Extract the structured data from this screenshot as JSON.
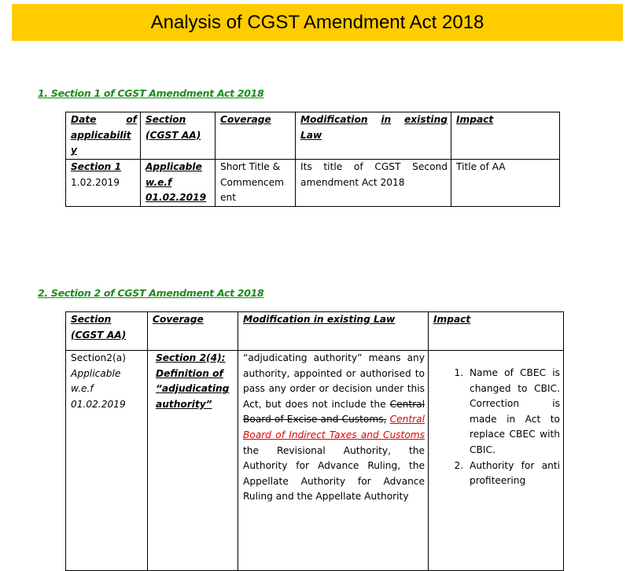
{
  "document": {
    "title": "Analysis of CGST Amendment Act 2018",
    "banner_color": "#FFCC00",
    "heading_color": "#1f8a1f",
    "insert_color": "#e00000"
  },
  "section1": {
    "heading": "1. Section 1 of CGST Amendment Act 2018",
    "columns": [
      "Date of applicabilit y",
      "Section (CGST AA)",
      "Coverage",
      "Modification in existing Law",
      "Impact"
    ],
    "col_date_a": "Date",
    "col_date_b": "of",
    "col_date_c": "applicabilit",
    "col_date_d": "y",
    "col_section_a": "Section",
    "col_section_b": "(CGST AA)",
    "col_coverage": "Coverage",
    "col_mod_a": "Modification",
    "col_mod_b": "in",
    "col_mod_c": "existing",
    "col_mod_d": "Law",
    "col_impact": "Impact",
    "rows": [
      {
        "date_label": "Section 1",
        "date_value": "1.02.2019",
        "section_a": "Applicable",
        "section_b": "w.e.f",
        "section_c": "01.02.2019",
        "coverage": "Short Title & Commencem ent",
        "coverage_a": "Short Title &",
        "coverage_b": "Commencem",
        "coverage_c": "ent",
        "modification": "Its title of CGST Second amendment Act 2018",
        "impact": "Title of AA"
      }
    ]
  },
  "section2": {
    "heading": "2. Section 2 of CGST Amendment Act 2018",
    "col_section_a": "Section",
    "col_section_b": "(CGST AA)",
    "col_coverage": "Coverage",
    "col_mod": "Modification in existing Law",
    "col_impact": "Impact",
    "rows": [
      {
        "section": "Section2(a)",
        "applicable_a": "Applicable",
        "applicable_b": "w.e.f",
        "applicable_c": "01.02.2019",
        "coverage_a": "Section 2(4):",
        "coverage_b": "Definition of",
        "coverage_c": "“adjudicating",
        "coverage_d": "authority”",
        "mod_before": "“adjudicating authority” means any authority, appointed or authorised to pass any order or decision under this Act, but does not include the ",
        "mod_deleted": "Central Board of Excise and Customs,",
        "mod_inserted": "Central Board of Indirect Taxes and Customs",
        "mod_after": " the Revisional Authority, the Authority for Advance Ruling, the Appellate Authority for Advance Ruling and the Appellate Authority",
        "impact_items": [
          "Name of CBEC is changed to CBIC. Correction is made in Act to replace CBEC with CBIC.",
          "Authority for anti profiteering"
        ]
      }
    ]
  }
}
